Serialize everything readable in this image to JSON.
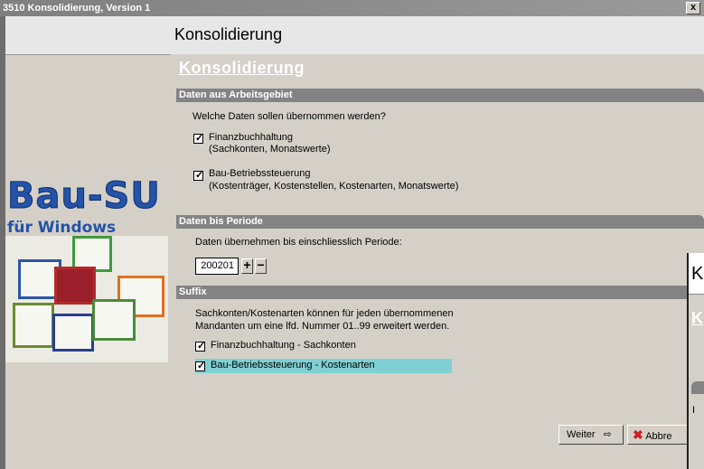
{
  "window": {
    "title": "3510 Konsolidierung, Version 1",
    "close_glyph": "x"
  },
  "header": {
    "title": "Konsolidierung"
  },
  "logo": {
    "name": "Bau-SU",
    "subtitle": "für Windows"
  },
  "main": {
    "heading": "Konsolidierung",
    "section1": {
      "title": "Daten aus Arbeitsgebiet",
      "question": "Welche Daten sollen übernommen werden?",
      "options": [
        {
          "label": "Finanzbuchhaltung",
          "detail": "(Sachkonten, Monatswerte)",
          "checked": true
        },
        {
          "label": "Bau-Betriebssteuerung",
          "detail": "(Kostenträger, Kostenstellen, Kostenarten, Monatswerte)",
          "checked": true
        }
      ]
    },
    "section2": {
      "title": "Daten bis Periode",
      "prompt": "Daten übernehmen bis einschliesslich Periode:",
      "period_value": "200201",
      "plus": "+",
      "minus": "−"
    },
    "section3": {
      "title": "Suffix",
      "text_line1": "Sachkonten/Kostenarten können für jeden übernommenen",
      "text_line2": "Mandanten um eine lfd. Nummer 01..99 erweitert werden.",
      "options": [
        {
          "label": "Finanzbuchhaltung - Sachkonten",
          "checked": true
        },
        {
          "label": "Bau-Betriebssteuerung - Kostenarten",
          "checked": true,
          "highlighted": true
        }
      ]
    }
  },
  "buttons": {
    "next": "Weiter",
    "cancel": "Abbre"
  },
  "overlay": {
    "k": "K",
    "u": "K",
    "i": "I"
  },
  "colors": {
    "section_bar": "#838383",
    "highlight": "#7fd0d3",
    "logo": "#2453a8"
  }
}
